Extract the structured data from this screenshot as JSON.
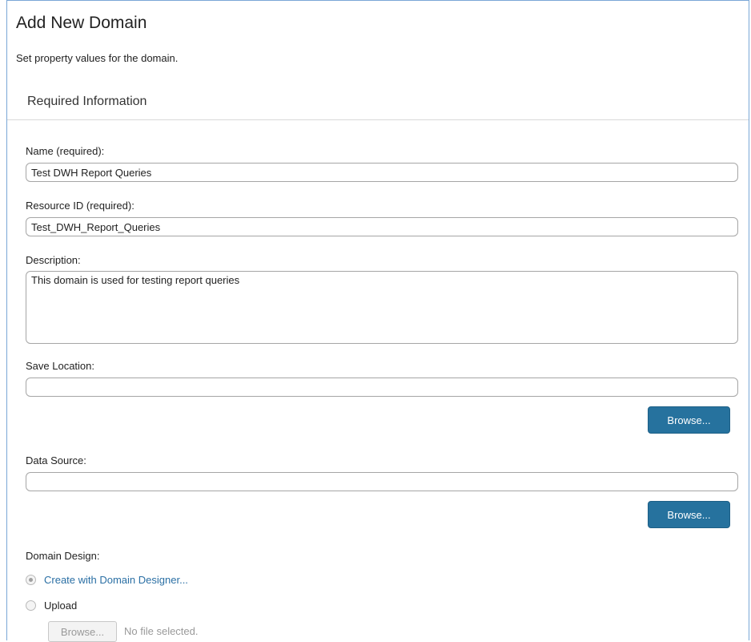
{
  "dialog": {
    "title": "Add New Domain",
    "subtitle": "Set property values for the domain.",
    "section_header": "Required Information"
  },
  "fields": {
    "name": {
      "label": "Name (required):",
      "value": "Test DWH Report Queries"
    },
    "resource_id": {
      "label": "Resource ID (required):",
      "value": "Test_DWH_Report_Queries"
    },
    "description": {
      "label": "Description:",
      "value": "This domain is used for testing report queries"
    },
    "save_location": {
      "label": "Save Location:",
      "value": ""
    },
    "data_source": {
      "label": "Data Source:",
      "value": ""
    }
  },
  "buttons": {
    "browse_save_location": "Browse...",
    "browse_data_source": "Browse...",
    "browse_file": "Browse..."
  },
  "domain_design": {
    "label": "Domain Design:",
    "option_designer": "Create with Domain Designer...",
    "option_upload": "Upload",
    "selected": "designer",
    "file_status": "No file selected."
  },
  "colors": {
    "primary_button": "#26729e",
    "link": "#2a6fa4",
    "frame_border": "#7aa7d6"
  }
}
